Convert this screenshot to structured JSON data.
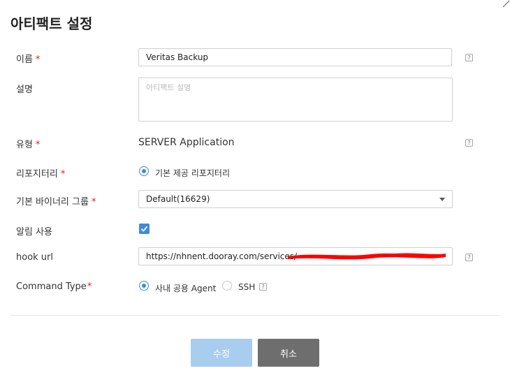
{
  "title": "아티팩트 설정",
  "fields": {
    "name": {
      "label": "이름",
      "required": "*",
      "value": "Veritas Backup",
      "help": "?"
    },
    "description": {
      "label": "설명",
      "placeholder": "아티팩트 설명"
    },
    "type": {
      "label": "유형",
      "required": "*",
      "value": "SERVER Application",
      "help": "?"
    },
    "repository": {
      "label": "리포지터리",
      "required": "*",
      "option": "기본 제공 리포지터리",
      "selected": true
    },
    "binary_group": {
      "label": "기본 바이너리 그룹",
      "required": "*",
      "value": "Default(16629)"
    },
    "notify": {
      "label": "알림 사용",
      "checked": true
    },
    "hook_url": {
      "label": "hook url",
      "value": "https://nhnent.dooray.com/services/",
      "help": "?"
    },
    "command_type": {
      "label": "Command Type",
      "required": "*",
      "options": [
        {
          "label": "사내 공용 Agent",
          "selected": true
        },
        {
          "label": "SSH",
          "selected": false
        }
      ],
      "help": "?"
    }
  },
  "buttons": {
    "submit": "수정",
    "cancel": "취소"
  },
  "colors": {
    "accent": "#3d8cd8",
    "required": "#e02020",
    "submit_bg": "#a9cdee",
    "cancel_bg": "#6e6e6e",
    "redaction": "#ff0000"
  }
}
